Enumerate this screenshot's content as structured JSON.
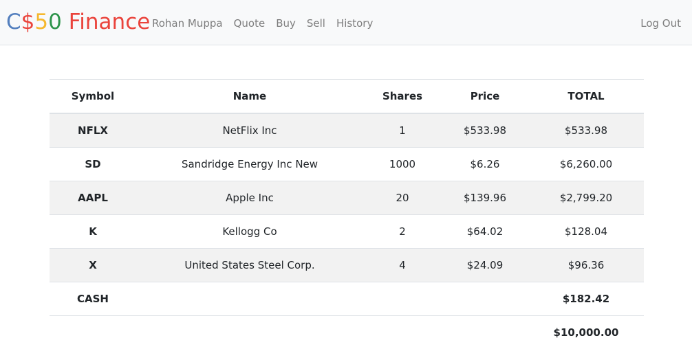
{
  "navbar": {
    "brand": {
      "parts": [
        {
          "text": "C",
          "color": "#537fbe"
        },
        {
          "text": "$",
          "color": "#ea433b"
        },
        {
          "text": "5",
          "color": "#f5b82e"
        },
        {
          "text": "0",
          "color": "#2e944b"
        },
        {
          "text": " Finance",
          "color": "#ea433b"
        }
      ]
    },
    "links": [
      "Rohan Muppa",
      "Quote",
      "Buy",
      "Sell",
      "History"
    ],
    "logout": "Log Out"
  },
  "table": {
    "headers": [
      "Symbol",
      "Name",
      "Shares",
      "Price",
      "TOTAL"
    ],
    "rows": [
      {
        "symbol": "NFLX",
        "name": "NetFlix Inc",
        "shares": "1",
        "price": "$533.98",
        "total": "$533.98"
      },
      {
        "symbol": "SD",
        "name": "Sandridge Energy Inc New",
        "shares": "1000",
        "price": "$6.26",
        "total": "$6,260.00"
      },
      {
        "symbol": "AAPL",
        "name": "Apple Inc",
        "shares": "20",
        "price": "$139.96",
        "total": "$2,799.20"
      },
      {
        "symbol": "K",
        "name": "Kellogg Co",
        "shares": "2",
        "price": "$64.02",
        "total": "$128.04"
      },
      {
        "symbol": "X",
        "name": "United States Steel Corp.",
        "shares": "4",
        "price": "$24.09",
        "total": "$96.36"
      }
    ],
    "cash": {
      "label": "CASH",
      "value": "$182.42"
    },
    "grand_total": "$10,000.00"
  }
}
